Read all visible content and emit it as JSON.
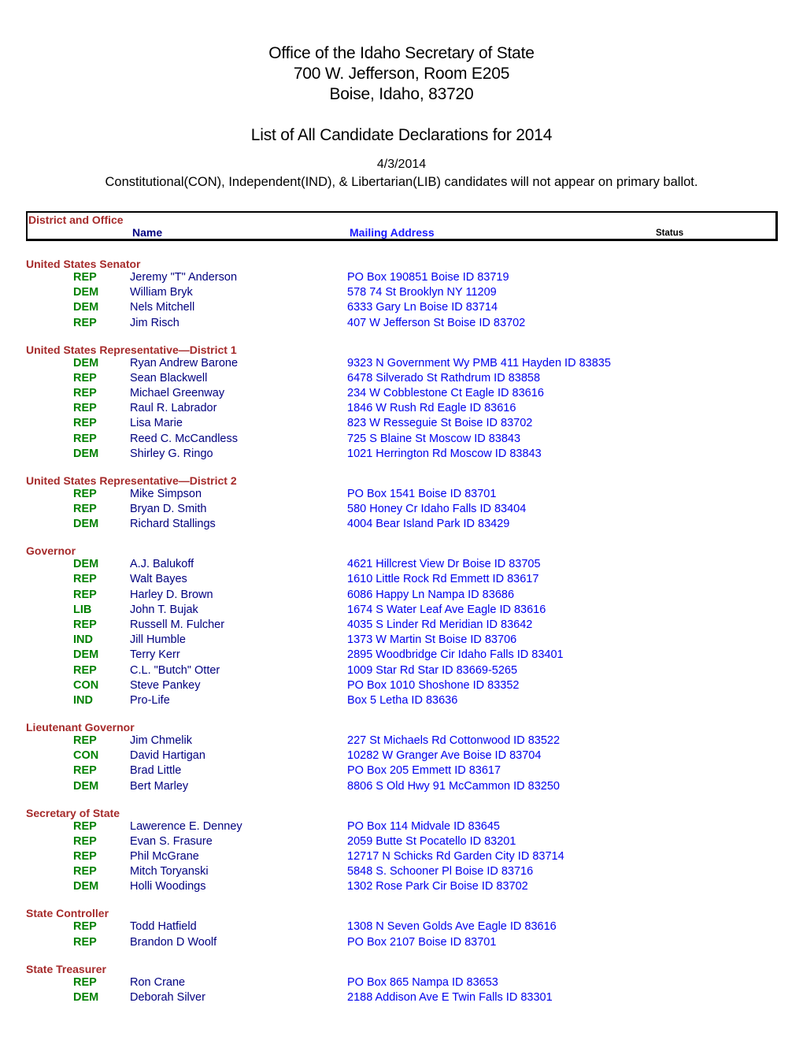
{
  "header": {
    "office_name": "Office of the Idaho Secretary of State",
    "address_line1": "700 W. Jefferson, Room E205",
    "address_line2": "Boise, Idaho, 83720",
    "list_title": "List of All Candidate Declarations for 2014",
    "date": "4/3/2014",
    "ballot_note": "Constitutional(CON), Independent(IND), & Libertarian(LIB) candidates will not appear on primary ballot."
  },
  "columns": {
    "district_office": "District and Office",
    "name": "Name",
    "mailing_address": "Mailing Address",
    "status": "Status"
  },
  "colors": {
    "office_heading": "#A52A2A",
    "party": "#008000",
    "candidate_name": "#000080",
    "address": "#0000EE"
  },
  "sections": [
    {
      "office": "United States Senator",
      "candidates": [
        {
          "party": "REP",
          "name": "Jeremy \"T\" Anderson",
          "address": "PO Box 190851 Boise ID 83719"
        },
        {
          "party": "DEM",
          "name": "William Bryk",
          "address": "578 74 St Brooklyn NY 11209"
        },
        {
          "party": "DEM",
          "name": "Nels Mitchell",
          "address": "6333 Gary Ln Boise ID 83714"
        },
        {
          "party": "REP",
          "name": "Jim Risch",
          "address": "407 W Jefferson St Boise ID 83702"
        }
      ]
    },
    {
      "office": "United States Representative—District 1",
      "candidates": [
        {
          "party": "DEM",
          "name": "Ryan Andrew Barone",
          "address": "9323 N Government Wy PMB 411 Hayden ID 83835"
        },
        {
          "party": "REP",
          "name": "Sean Blackwell",
          "address": "6478 Silverado St Rathdrum ID 83858"
        },
        {
          "party": "REP",
          "name": "Michael Greenway",
          "address": "234 W Cobblestone Ct Eagle ID 83616"
        },
        {
          "party": "REP",
          "name": "Raul R. Labrador",
          "address": "1846 W Rush Rd Eagle ID 83616"
        },
        {
          "party": "REP",
          "name": "Lisa Marie",
          "address": "823 W Resseguie St Boise ID 83702"
        },
        {
          "party": "REP",
          "name": "Reed C. McCandless",
          "address": "725 S Blaine St Moscow ID 83843"
        },
        {
          "party": "DEM",
          "name": "Shirley G. Ringo",
          "address": "1021 Herrington Rd Moscow ID 83843"
        }
      ]
    },
    {
      "office": "United States Representative—District 2",
      "candidates": [
        {
          "party": "REP",
          "name": "Mike Simpson",
          "address": "PO Box 1541 Boise ID 83701"
        },
        {
          "party": "REP",
          "name": "Bryan D. Smith",
          "address": "580 Honey Cr Idaho Falls ID 83404"
        },
        {
          "party": "DEM",
          "name": "Richard Stallings",
          "address": "4004 Bear Island Park ID 83429"
        }
      ]
    },
    {
      "office": "Governor",
      "candidates": [
        {
          "party": "DEM",
          "name": "A.J. Balukoff",
          "address": "4621 Hillcrest View Dr Boise ID 83705"
        },
        {
          "party": "REP",
          "name": "Walt Bayes",
          "address": "1610 Little Rock Rd Emmett ID 83617"
        },
        {
          "party": "REP",
          "name": "Harley D. Brown",
          "address": "6086 Happy Ln Nampa ID 83686"
        },
        {
          "party": "LIB",
          "name": "John T. Bujak",
          "address": "1674 S Water Leaf Ave Eagle ID 83616"
        },
        {
          "party": "REP",
          "name": "Russell M. Fulcher",
          "address": "4035 S Linder Rd Meridian ID 83642"
        },
        {
          "party": "IND",
          "name": "Jill Humble",
          "address": "1373 W Martin St Boise ID 83706"
        },
        {
          "party": "DEM",
          "name": "Terry Kerr",
          "address": "2895 Woodbridge Cir Idaho Falls ID 83401"
        },
        {
          "party": "REP",
          "name": "C.L. \"Butch\" Otter",
          "address": "1009 Star Rd Star ID 83669-5265"
        },
        {
          "party": "CON",
          "name": "Steve Pankey",
          "address": "PO Box 1010 Shoshone ID 83352"
        },
        {
          "party": "IND",
          "name": "Pro-Life",
          "address": "Box 5 Letha ID 83636"
        }
      ]
    },
    {
      "office": "Lieutenant Governor",
      "candidates": [
        {
          "party": "REP",
          "name": "Jim Chmelik",
          "address": "227 St Michaels Rd Cottonwood ID 83522"
        },
        {
          "party": "CON",
          "name": "David Hartigan",
          "address": "10282 W Granger Ave Boise ID 83704"
        },
        {
          "party": "REP",
          "name": "Brad Little",
          "address": "PO Box 205 Emmett ID 83617"
        },
        {
          "party": "DEM",
          "name": "Bert Marley",
          "address": "8806 S Old Hwy 91 McCammon ID 83250"
        }
      ]
    },
    {
      "office": "Secretary of State",
      "candidates": [
        {
          "party": "REP",
          "name": "Lawerence E. Denney",
          "address": "PO Box 114 Midvale ID 83645"
        },
        {
          "party": "REP",
          "name": "Evan S. Frasure",
          "address": "2059 Butte St Pocatello ID 83201"
        },
        {
          "party": "REP",
          "name": "Phil McGrane",
          "address": "12717 N Schicks Rd Garden City ID 83714"
        },
        {
          "party": "REP",
          "name": "Mitch Toryanski",
          "address": "5848 S. Schooner Pl Boise ID 83716"
        },
        {
          "party": "DEM",
          "name": "Holli Woodings",
          "address": "1302 Rose Park Cir Boise ID 83702"
        }
      ]
    },
    {
      "office": "State Controller",
      "candidates": [
        {
          "party": "REP",
          "name": "Todd Hatfield",
          "address": "1308 N Seven Golds Ave Eagle ID 83616"
        },
        {
          "party": "REP",
          "name": "Brandon D Woolf",
          "address": "PO Box 2107 Boise ID 83701"
        }
      ]
    },
    {
      "office": "State Treasurer",
      "candidates": [
        {
          "party": "REP",
          "name": "Ron Crane",
          "address": "PO Box 865 Nampa ID 83653"
        },
        {
          "party": "DEM",
          "name": "Deborah Silver",
          "address": "2188 Addison Ave E Twin Falls ID 83301"
        }
      ]
    }
  ]
}
